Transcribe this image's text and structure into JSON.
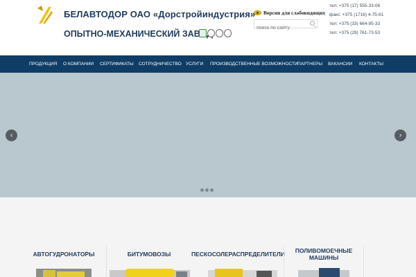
{
  "header": {
    "title_line1": "БЕЛАВТОДОР ОАО «Дорстройиндустрия»",
    "title_line2": "ОПЫТНО-МЕХАНИЧЕСКИЙ ЗАВОД",
    "vision_label": "Версия для слабовидящих",
    "search_placeholder": "поиск по сайту",
    "phones": [
      "тел: +375 (17) 555-33-06",
      "факс: +375 (1716) 4-75-61",
      "тел: +375 (33) 664-95-33",
      "тел: +375 (29) 761-73-53"
    ]
  },
  "nav": {
    "items": [
      "Продукция",
      "О компании",
      "Сертификаты",
      "Сотрудничество",
      "Услуги",
      "Производственные возможности",
      "Партнеры",
      "Вакансии",
      "Контакты"
    ]
  },
  "slider": {
    "prev": "‹",
    "next": "›"
  },
  "categories": [
    {
      "line1": "Автогудронаторы",
      "line2": ""
    },
    {
      "line1": "Битумовозы",
      "line2": ""
    },
    {
      "line1": "Пескосолераспределители",
      "line2": ""
    },
    {
      "line1": "Поливомоечные",
      "line2": "машины"
    }
  ],
  "colors": {
    "nav_bg": "#0f3d66",
    "brand_text": "#1f3a5c",
    "slider_bg": "#b9c8cf",
    "logo_yellow": "#f2c200"
  }
}
